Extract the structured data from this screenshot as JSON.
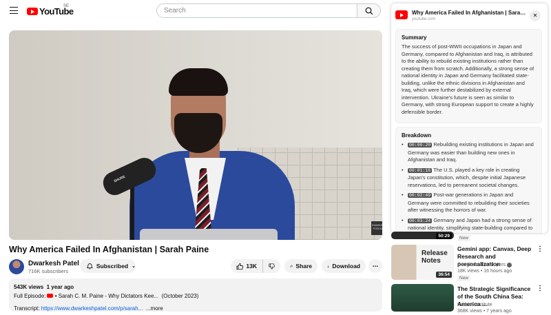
{
  "header": {
    "logo_text": "YouTube",
    "logo_country": "SE",
    "search_placeholder": "Search"
  },
  "video": {
    "title": "Why America Failed In Afghanistan | Sarah Paine",
    "mic_brand": "SHURE",
    "podcast_badge": "DWARKESH PODCAST"
  },
  "channel": {
    "name": "Dwarkesh Patel",
    "subscribers": "716K subscribers",
    "subscribe_label": "Subscribed"
  },
  "actions": {
    "likes": "13K",
    "share": "Share",
    "download": "Download",
    "more": "..."
  },
  "description": {
    "views": "543K views",
    "age": "1 year ago",
    "line1_prefix": "Full Episode:",
    "line1_link": "• Sarah C. M. Paine - Why Dictators Kee...",
    "line1_suffix": "(October 2023)",
    "line2_prefix": "Transcript:",
    "line2_link": "https://www.dwarkeshpatel.com/p/sarah...",
    "more_label": "...more"
  },
  "panel": {
    "title": "Why America Failed In Afghanistan | Sarah P...",
    "source": "youtube.com",
    "summary_heading": "Summary",
    "summary": "The success of post-WWII occupations in Japan and Germany, compared to Afghanistan and Iraq, is attributed to the ability to rebuild existing institutions rather than creating them from scratch. Additionally, a strong sense of national identity in Japan and Germany facilitated state-building, unlike the ethnic divisions in Afghanistan and Iraq, which were further destabilized by external intervention. Ukraine's future is seen as similar to Germany, with strong European support to create a highly defensible border.",
    "breakdown_heading": "Breakdown",
    "breakdown": [
      {
        "ts": "00:00:20",
        "text": "Rebuilding existing institutions in Japan and Germany was easier than building new ones in Afghanistan and Iraq."
      },
      {
        "ts": "00:01:16",
        "text": "The U.S. played a key role in creating Japan's constitution, which, despite initial Japanese reservations, led to permanent societal changes."
      },
      {
        "ts": "00:02:49",
        "text": "Post-war generations in Japan and Germany were committed to rebuilding their societies after witnessing the horrors of war."
      },
      {
        "ts": "00:03:24",
        "text": "Germany and Japan had a strong sense of national identity, simplifying state-building compared to Afghanistan and Iraq's ethnic divisions"
      }
    ]
  },
  "recommendations": [
    {
      "duration": "50:29",
      "title": "",
      "channel": "",
      "meta": "",
      "badge": "New"
    },
    {
      "duration": "36:54",
      "thumb_text": "Release Notes",
      "title": "Gemini app: Canvas, Deep Research and personalization",
      "channel": "Google for Developers",
      "meta": "18K views • 16 hours ago",
      "badge": "New"
    },
    {
      "duration": "",
      "title": "The Strategic Significance of the South China Sea: America ...",
      "channel": "Hudson Institute",
      "meta": "368K views • 7 years ago",
      "badge": ""
    }
  ]
}
